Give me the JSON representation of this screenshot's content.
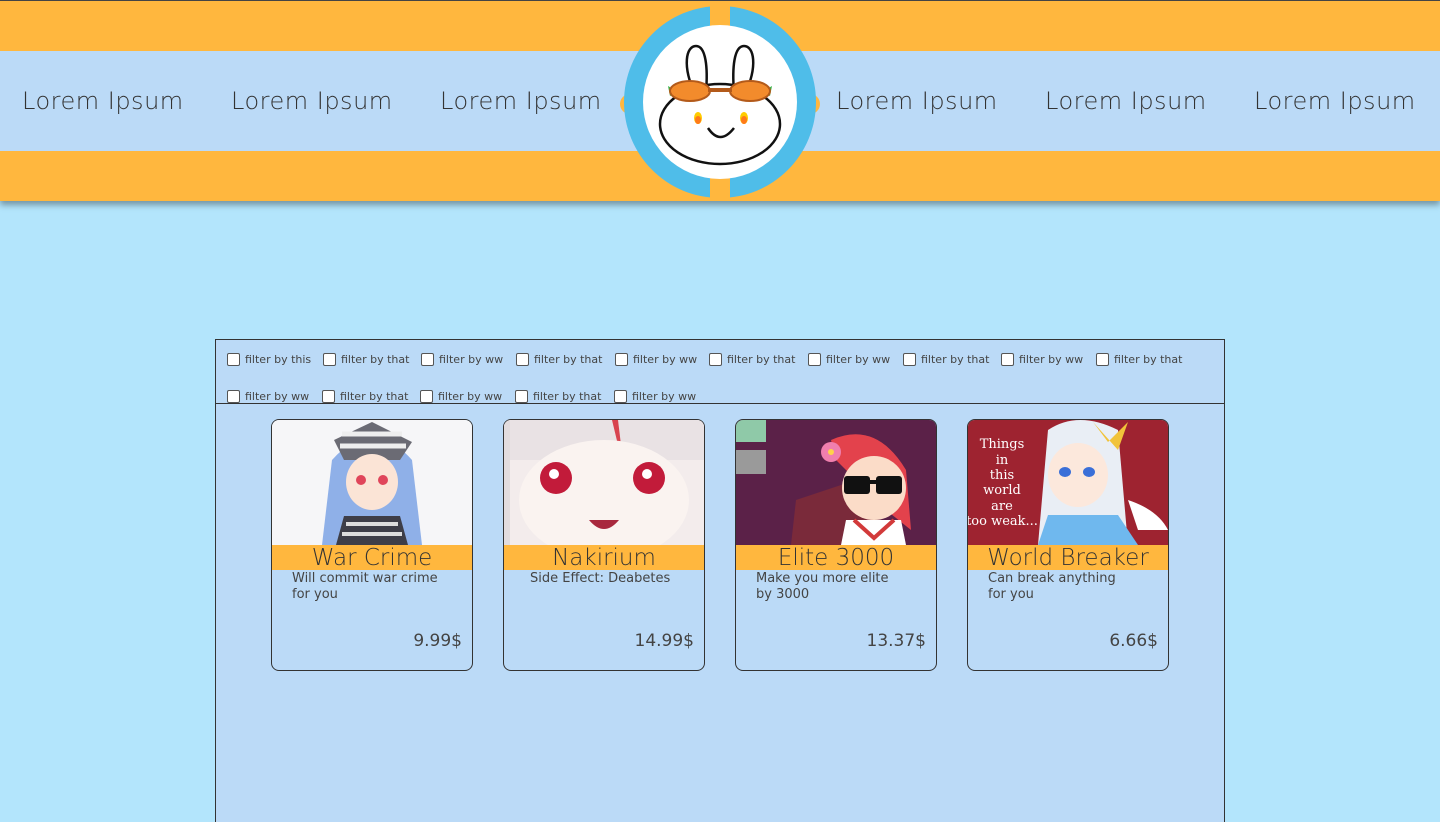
{
  "nav": {
    "left": [
      "Lorem Ipsum",
      "Lorem Ipsum",
      "Lorem Ipsum"
    ],
    "right": [
      "Lorem Ipsum",
      "Lorem Ipsum",
      "Lorem Ipsum"
    ]
  },
  "logo": {
    "name": "bunny-logo-icon"
  },
  "filters": [
    "filter by this",
    "filter by that",
    "filter by ww",
    "filter by that",
    "filter by ww",
    "filter by that",
    "filter by ww",
    "filter by that",
    "filter by ww",
    "filter by that",
    "filter by ww",
    "filter by that",
    "filter by ww",
    "filter by that",
    "filter by ww"
  ],
  "products": [
    {
      "title": "War Crime",
      "desc1": "Will commit war crime",
      "desc2": "for you",
      "price": "9.99$"
    },
    {
      "title": "Nakirium",
      "desc1": "Side Effect: Deabetes",
      "desc2": "",
      "price": "14.99$"
    },
    {
      "title": "Elite 3000",
      "desc1": "Make you more elite",
      "desc2": "by 3000",
      "price": "13.37$"
    },
    {
      "title": "World Breaker",
      "desc1": "Can break anything",
      "desc2": "for you",
      "price": "6.66$",
      "image_text": [
        "Things",
        "in",
        "this",
        "world",
        "are",
        "too weak..."
      ]
    }
  ],
  "colors": {
    "background": "#b3e5fc",
    "band": "#bbdaf7",
    "accent": "#ffb73e",
    "logo_ring": "#4fbde9"
  }
}
